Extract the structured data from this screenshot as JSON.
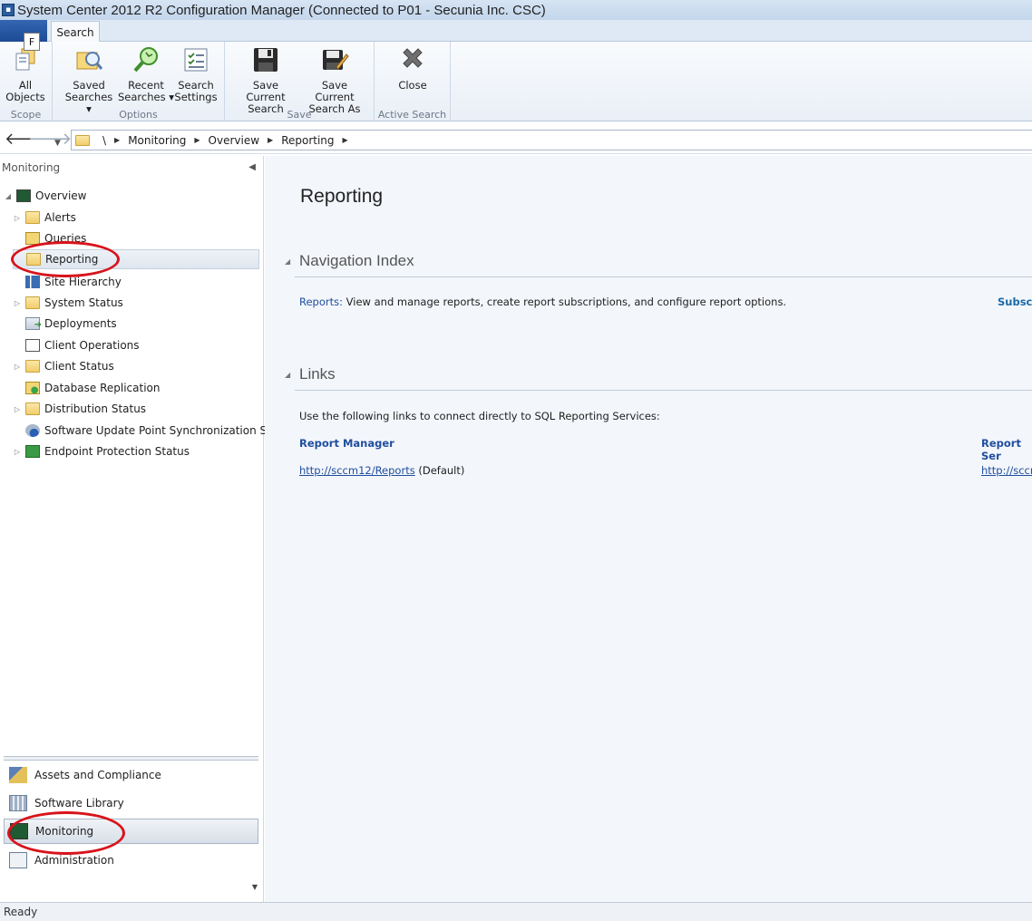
{
  "window": {
    "title": "System Center 2012 R2 Configuration Manager (Connected to P01 - Secunia Inc. CSC)"
  },
  "ribbon": {
    "file_badge": "F",
    "tab_search": "Search",
    "groups": {
      "scope": "Scope",
      "options": "Options",
      "save": "Save",
      "active_search": "Active Search"
    },
    "buttons": {
      "all_objects": [
        "All",
        "Objects"
      ],
      "saved_searches": [
        "Saved",
        "Searches ▾"
      ],
      "recent_searches": [
        "Recent",
        "Searches ▾"
      ],
      "search_settings": [
        "Search",
        "Settings"
      ],
      "save_current_search": [
        "Save Current",
        "Search"
      ],
      "save_current_search_as": [
        "Save Current",
        "Search As"
      ],
      "close": [
        "Close",
        ""
      ]
    }
  },
  "address": {
    "root": "\\",
    "crumbs": [
      "Monitoring",
      "Overview",
      "Reporting"
    ]
  },
  "nav": {
    "header": "Monitoring",
    "tree": {
      "overview": "Overview",
      "alerts": "Alerts",
      "queries": "Queries",
      "reporting": "Reporting",
      "site_hierarchy": "Site Hierarchy",
      "system_status": "System Status",
      "deployments": "Deployments",
      "client_operations": "Client Operations",
      "client_status": "Client Status",
      "database_replication": "Database Replication",
      "distribution_status": "Distribution Status",
      "software_update_sync": "Software Update Point Synchronization Status",
      "endpoint_protection": "Endpoint Protection Status"
    },
    "workspaces": {
      "assets": "Assets and Compliance",
      "software_library": "Software Library",
      "monitoring": "Monitoring",
      "administration": "Administration"
    }
  },
  "main": {
    "title": "Reporting",
    "navigation_index": {
      "title": "Navigation Index",
      "reports_label": "Reports:",
      "reports_desc": "View and manage reports, create report subscriptions, and configure report options.",
      "subscriptions_label": "Subscri"
    },
    "links": {
      "title": "Links",
      "intro": "Use the following links to connect directly to SQL Reporting Services:",
      "report_manager_label": "Report Manager",
      "report_manager_url": "http://sccm12/Reports",
      "report_manager_suffix": "(Default)",
      "report_server_label": "Report Ser",
      "report_server_url": "http://sccm"
    }
  },
  "status": {
    "text": "Ready"
  },
  "colors": {
    "accent": "#1f4e9e",
    "annotation": "#d8131b"
  }
}
